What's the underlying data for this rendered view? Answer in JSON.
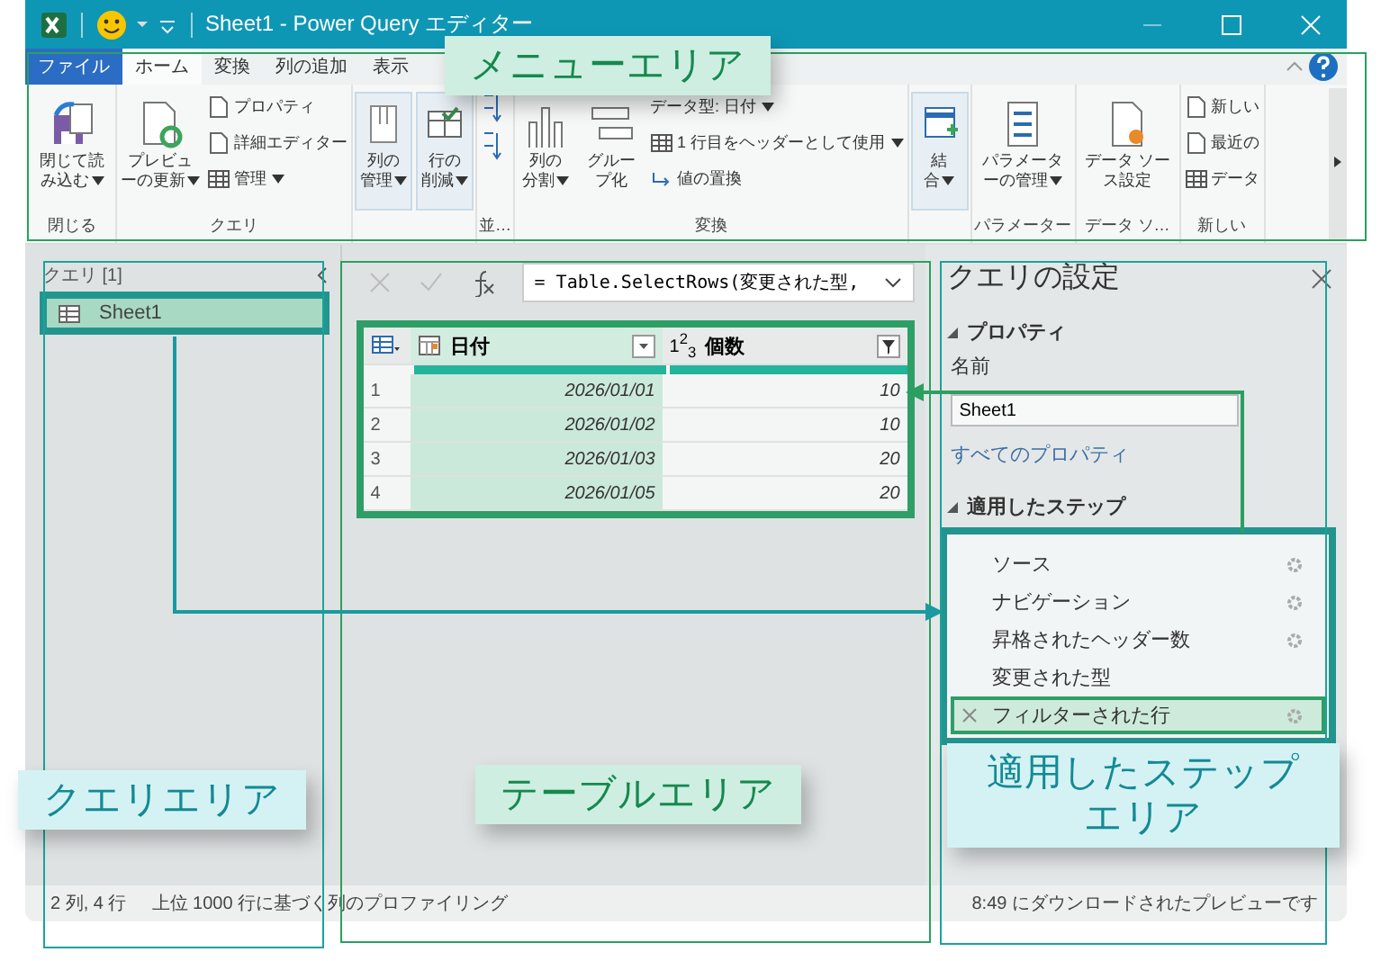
{
  "window": {
    "title": "Sheet1 - Power Query エディター"
  },
  "tabs": [
    {
      "label": "ファイル",
      "selected": false,
      "kind": "file"
    },
    {
      "label": "ホーム",
      "selected": true,
      "kind": "tab"
    },
    {
      "label": "変換",
      "selected": false,
      "kind": "tab"
    },
    {
      "label": "列の追加",
      "selected": false,
      "kind": "tab"
    },
    {
      "label": "表示",
      "selected": false,
      "kind": "tab"
    }
  ],
  "ribbon_groups": [
    {
      "label": "閉じる",
      "items": [
        {
          "kind": "large",
          "label": "閉じて読み込む",
          "has_menu": true
        }
      ]
    },
    {
      "label": "クエリ",
      "items": [
        {
          "kind": "large",
          "label": "プレビューの更新",
          "has_menu": true
        },
        {
          "kind": "stack",
          "entries": [
            {
              "label": "プロパティ",
              "has_menu": false
            },
            {
              "label": "詳細エディター",
              "has_menu": false
            },
            {
              "label": "管理",
              "has_menu": true
            }
          ]
        }
      ]
    },
    {
      "items": [
        {
          "kind": "large",
          "label": "列の管理",
          "has_menu": true,
          "framed": true
        },
        {
          "kind": "large",
          "label": "行の削減",
          "has_menu": true,
          "framed": true
        }
      ]
    },
    {
      "label": "並…",
      "items": [
        {
          "kind": "sort"
        }
      ]
    },
    {
      "label": "変換",
      "items": [
        {
          "kind": "large",
          "label": "列の分割",
          "has_menu": true
        },
        {
          "kind": "large",
          "label": "グループ化",
          "has_menu": false
        },
        {
          "kind": "stack",
          "entries": [
            {
              "label": "データ型: 日付",
              "has_menu": true
            },
            {
              "label": "1 行目をヘッダーとして使用",
              "has_menu": true
            },
            {
              "label": "値の置換",
              "has_menu": false
            }
          ]
        }
      ]
    },
    {
      "items": [
        {
          "kind": "large",
          "label": "結合",
          "has_menu": true,
          "framed": true
        }
      ]
    },
    {
      "label": "パラメーター",
      "items": [
        {
          "kind": "large",
          "label": "パラメーターの管理",
          "has_menu": true
        }
      ]
    },
    {
      "label": "データ ソ…",
      "items": [
        {
          "kind": "large",
          "label": "データ ソース設定",
          "has_menu": false
        }
      ]
    },
    {
      "label": "新しい",
      "items": [
        {
          "kind": "stack",
          "entries": [
            {
              "label": "新しい",
              "has_menu": false
            },
            {
              "label": "最近の",
              "has_menu": false
            },
            {
              "label": "データ",
              "has_menu": false
            }
          ]
        }
      ]
    }
  ],
  "query_pane": {
    "header": "クエリ [1]",
    "items": [
      {
        "name": "Sheet1",
        "selected": true
      }
    ]
  },
  "formula_bar": {
    "formula": "= Table.SelectRows(変更された型,"
  },
  "table": {
    "columns": [
      {
        "name": "日付",
        "kind": "date",
        "selected": true
      },
      {
        "name": "個数",
        "kind": "number",
        "type_label": "1$^{2}$$_{3}$",
        "selected": false
      }
    ],
    "rows": [
      {
        "index": "1",
        "cells": [
          "2026/01/01",
          "10"
        ]
      },
      {
        "index": "2",
        "cells": [
          "2026/01/02",
          "10"
        ]
      },
      {
        "index": "3",
        "cells": [
          "2026/01/03",
          "20"
        ]
      },
      {
        "index": "4",
        "cells": [
          "2026/01/05",
          "20"
        ]
      }
    ]
  },
  "settings": {
    "title": "クエリの設定",
    "properties_heading": "プロパティ",
    "name_label": "名前",
    "name_value": "Sheet1",
    "all_properties_link": "すべてのプロパティ",
    "steps_heading": "適用したステップ",
    "steps": [
      {
        "name": "ソース",
        "has_settings": true,
        "selected": false
      },
      {
        "name": "ナビゲーション",
        "has_settings": true,
        "selected": false
      },
      {
        "name": "昇格されたヘッダー数",
        "has_settings": true,
        "selected": false
      },
      {
        "name": "変更された型",
        "has_settings": false,
        "selected": false
      },
      {
        "name": "フィルターされた行",
        "has_settings": true,
        "selected": true
      }
    ]
  },
  "status_bar": {
    "left": [
      "2 列, 4 行",
      "上位 1000 行に基づく列のプロファイリング"
    ],
    "right": "8:49 にダウンロードされたプレビューです"
  },
  "annotations": [
    {
      "text": "メニューエリア",
      "kind": "green"
    },
    {
      "text": "クエリエリア",
      "kind": "cyan"
    },
    {
      "text": "テーブルエリア",
      "kind": "green"
    },
    {
      "text": "適用したステップエリア",
      "kind": "cyan"
    }
  ]
}
